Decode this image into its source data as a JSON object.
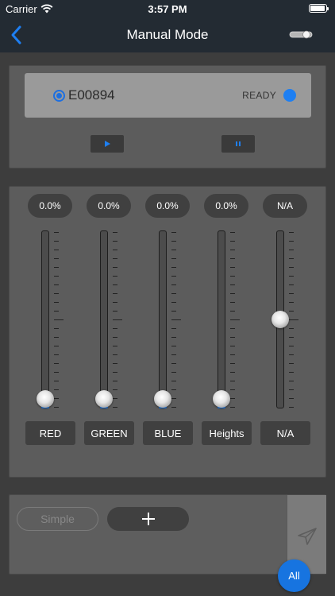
{
  "status_bar": {
    "carrier": "Carrier",
    "time": "3:57 PM"
  },
  "nav": {
    "title": "Manual Mode",
    "back_icon": "chevron-left-icon",
    "right_icon": "toggle-switch-icon"
  },
  "device": {
    "id": "E00894",
    "status": "READY",
    "status_color": "#1e7ff2",
    "selected": true
  },
  "controls": {
    "play_icon": "play-icon",
    "pause_icon": "pause-icon"
  },
  "sliders": [
    {
      "value": "0.0%",
      "label": "RED",
      "level": 0.0
    },
    {
      "value": "0.0%",
      "label": "GREEN",
      "level": 0.0
    },
    {
      "value": "0.0%",
      "label": "BLUE",
      "level": 0.0
    },
    {
      "value": "0.0%",
      "label": "Heights",
      "level": 0.0
    },
    {
      "value": "N/A",
      "label": "N/A",
      "level": 0.5
    }
  ],
  "bottom": {
    "simple_label": "Simple",
    "add_icon": "plus-icon",
    "send_icon": "send-icon",
    "all_label": "All"
  },
  "colors": {
    "accent": "#1e7ff2",
    "background": "#3d3d3d",
    "nav": "#232b33"
  }
}
